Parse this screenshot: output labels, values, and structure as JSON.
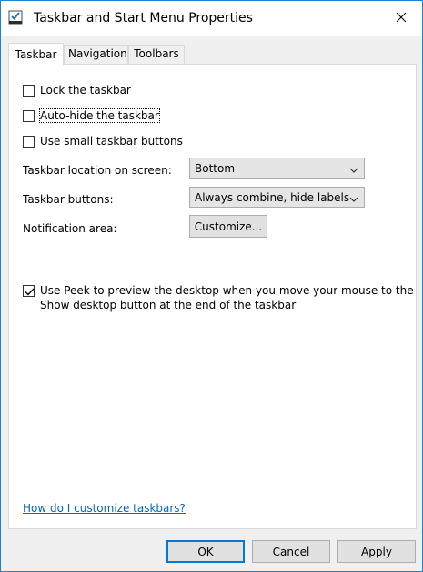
{
  "window": {
    "title": "Taskbar and Start Menu Properties"
  },
  "tabs": [
    {
      "label": "Taskbar",
      "active": true
    },
    {
      "label": "Navigation",
      "active": false
    },
    {
      "label": "Toolbars",
      "active": false
    }
  ],
  "options": {
    "lock_taskbar": {
      "label": "Lock the taskbar",
      "checked": false
    },
    "auto_hide": {
      "label": "Auto-hide the taskbar",
      "checked": false
    },
    "small_buttons": {
      "label": "Use small taskbar buttons",
      "checked": false
    }
  },
  "location": {
    "label": "Taskbar location on screen:",
    "value": "Bottom"
  },
  "buttons": {
    "label": "Taskbar buttons:",
    "value": "Always combine, hide labels"
  },
  "notification": {
    "label": "Notification area:",
    "button": "Customize..."
  },
  "peek": {
    "label_line1": "Use Peek to preview the desktop when you move your mouse to the",
    "label_line2": "Show desktop button at the end of the taskbar",
    "checked": true
  },
  "help_link": "How do I customize taskbars?",
  "footer": {
    "ok": "OK",
    "cancel": "Cancel",
    "apply": "Apply"
  },
  "icons": {
    "app": "taskbar-properties-icon",
    "close": "close-icon",
    "chevron": "chevron-down-icon",
    "check": "check-icon"
  }
}
